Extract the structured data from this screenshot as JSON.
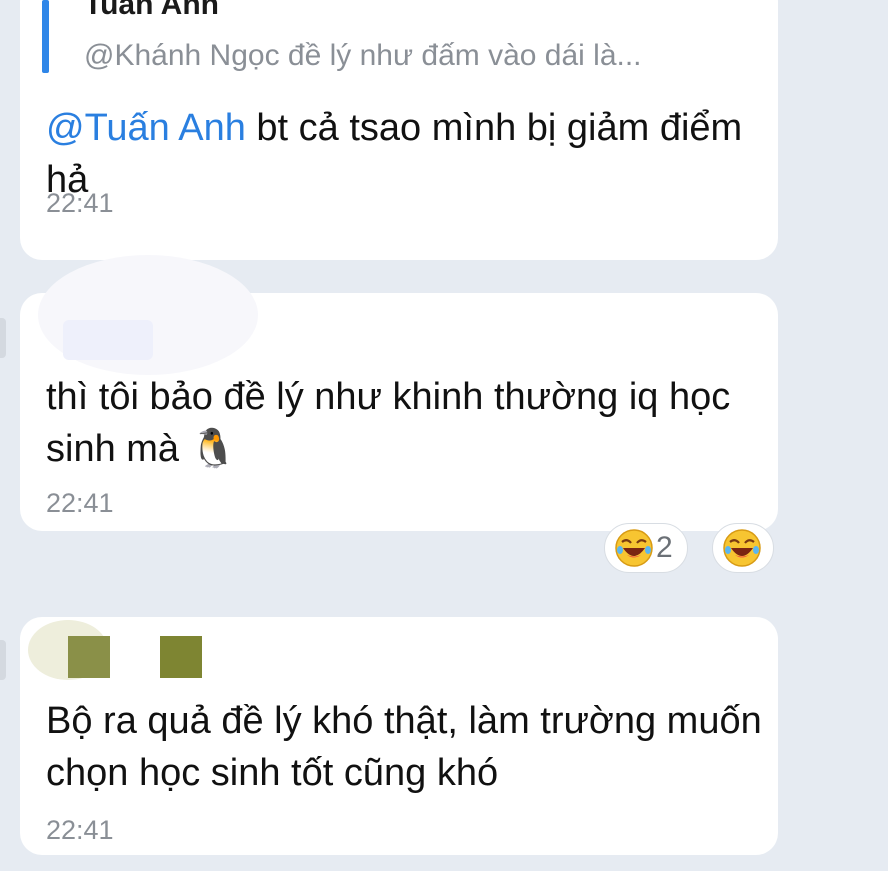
{
  "messages": [
    {
      "reply": {
        "author": "Tuấn Anh",
        "text": "@Khánh Ngọc đề lý như đấm vào dái là..."
      },
      "mention": "@Tuấn Anh",
      "text": " bt cả tsao mình bị giảm điểm hả",
      "time": "22:41"
    },
    {
      "text": "thì tôi bảo đề lý như khinh thường iq học sinh mà",
      "emoji": "🐧",
      "time": "22:41",
      "reactions": [
        {
          "icon": "laughing-face",
          "count": "2"
        },
        {
          "icon": "laughing-face",
          "count": ""
        }
      ]
    },
    {
      "text": "Bộ ra quả đề lý khó thật, làm trường muốn chọn học sinh tốt cũng khó",
      "time": "22:41"
    }
  ],
  "colors": {
    "background": "#e6ebf2",
    "bubble": "#ffffff",
    "accent": "#2a7fe0",
    "timestamp": "#8a8f96"
  }
}
